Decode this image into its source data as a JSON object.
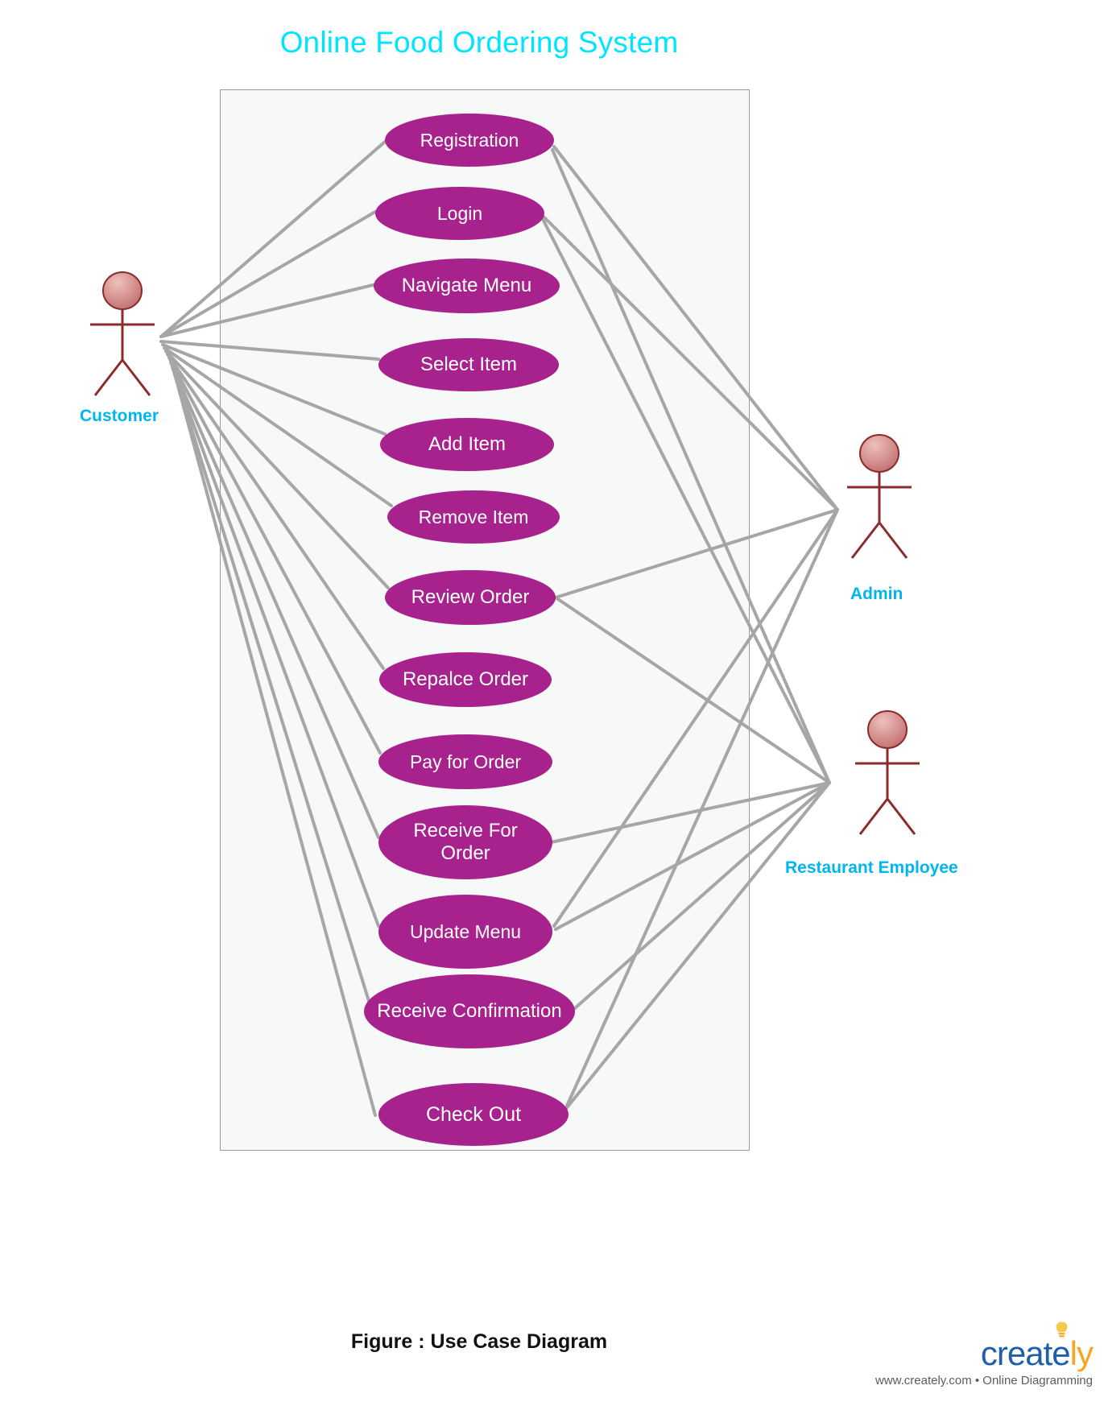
{
  "title": "Online Food Ordering System",
  "caption": "Figure :  Use Case Diagram",
  "colors": {
    "title": "#00E5FF",
    "usecase_fill": "#A8228E",
    "usecase_text": "#FFFFFF",
    "actor_label": "#00B6F0",
    "actor_stroke": "#8C2B2B",
    "actor_head_fill": "#D98888",
    "edge": "#A6A6A6",
    "boundary_fill": "#F7F8F8",
    "boundary_stroke": "#9A9A9A",
    "brand_primary": "#1F5FA9",
    "brand_accent": "#F5A623"
  },
  "actors": [
    {
      "id": "customer",
      "label": "Customer"
    },
    {
      "id": "admin",
      "label": "Admin"
    },
    {
      "id": "restaurant_employee",
      "label": "Restaurant Employee"
    }
  ],
  "use_cases": [
    {
      "id": "registration",
      "label": "Registration"
    },
    {
      "id": "login",
      "label": "Login"
    },
    {
      "id": "navigate_menu",
      "label": "Navigate Menu"
    },
    {
      "id": "select_item",
      "label": "Select Item"
    },
    {
      "id": "add_item",
      "label": "Add Item"
    },
    {
      "id": "remove_item",
      "label": "Remove Item"
    },
    {
      "id": "review_order",
      "label": "Review Order"
    },
    {
      "id": "repalce_order",
      "label": "Repalce Order"
    },
    {
      "id": "pay_for_order",
      "label": "Pay for Order"
    },
    {
      "id": "receive_for_order",
      "label": "Receive For Order"
    },
    {
      "id": "update_menu",
      "label": "Update Menu"
    },
    {
      "id": "receive_confirmation",
      "label": "Receive Confirmation"
    },
    {
      "id": "check_out",
      "label": "Check Out"
    }
  ],
  "brand": {
    "name_part1": "creat",
    "name_part2": "e",
    "name_part3": "ly",
    "tagline": "www.creately.com • Online Diagramming"
  }
}
